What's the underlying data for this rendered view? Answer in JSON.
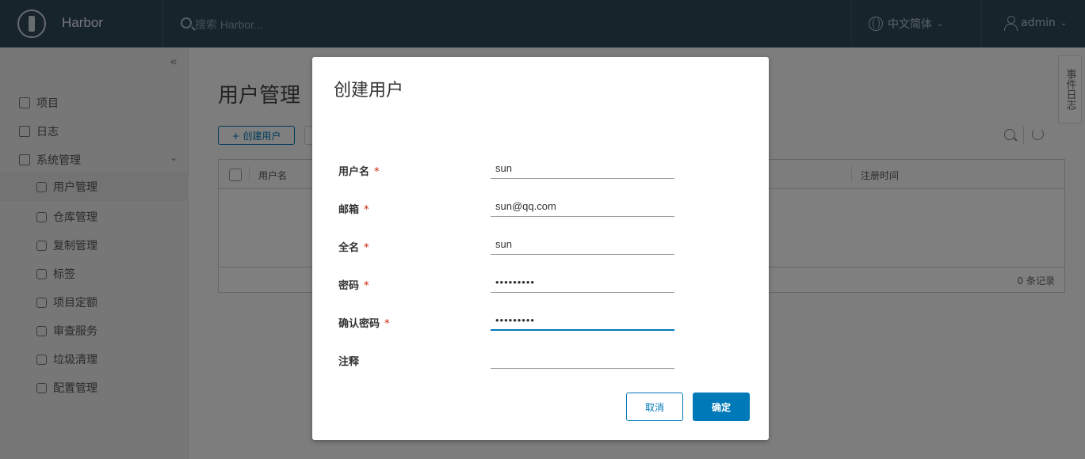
{
  "header": {
    "brand": "Harbor",
    "search_placeholder": "搜索 Harbor...",
    "language": "中文简体",
    "user": "admin"
  },
  "sidebar": {
    "items": [
      {
        "label": "项目",
        "icon": "project-icon"
      },
      {
        "label": "日志",
        "icon": "log-icon"
      },
      {
        "label": "系统管理",
        "icon": "admin-icon"
      }
    ],
    "sub_items": [
      {
        "label": "用户管理",
        "icon": "users-icon"
      },
      {
        "label": "仓库管理",
        "icon": "registry-icon"
      },
      {
        "label": "复制管理",
        "icon": "replication-icon"
      },
      {
        "label": "标签",
        "icon": "tag-icon"
      },
      {
        "label": "项目定额",
        "icon": "quota-icon"
      },
      {
        "label": "审查服务",
        "icon": "shield-icon"
      },
      {
        "label": "垃圾清理",
        "icon": "trash-icon"
      },
      {
        "label": "配置管理",
        "icon": "gear-icon"
      }
    ]
  },
  "main": {
    "title": "用户管理",
    "create_button": "+ 创建用户",
    "table": {
      "columns": [
        "用户名",
        "注册时间"
      ],
      "footer": "0 条记录"
    },
    "event_tab": "事件日志"
  },
  "modal": {
    "title": "创建用户",
    "fields": [
      {
        "label": "用户名",
        "required": true,
        "value": "sun"
      },
      {
        "label": "邮箱",
        "required": true,
        "value": "sun@qq.com"
      },
      {
        "label": "全名",
        "required": true,
        "value": "sun"
      },
      {
        "label": "密码",
        "required": true,
        "value": "•••••••••"
      },
      {
        "label": "确认密码",
        "required": true,
        "value": "•••••••••"
      },
      {
        "label": "注释",
        "required": false,
        "value": ""
      }
    ],
    "required_mark": "*",
    "cancel": "取消",
    "confirm": "确定"
  },
  "colors": {
    "header_bg": "#314959",
    "primary": "#0079b8",
    "required": "#c92100"
  }
}
